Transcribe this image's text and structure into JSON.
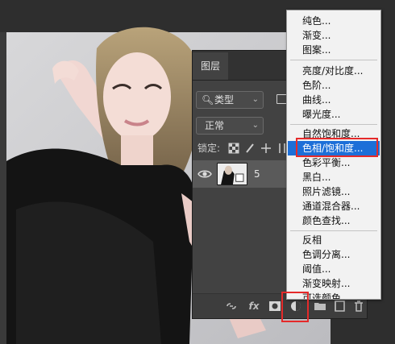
{
  "panel": {
    "tab_label": "图层",
    "filter_label": "类型",
    "blend_mode": "正常",
    "lock_label": "锁定:",
    "layers": [
      {
        "name": "5",
        "visible": true
      }
    ]
  },
  "footer_icons": [
    "link-icon",
    "fx-icon",
    "mask-icon",
    "adjustment-icon",
    "group-icon",
    "new-layer-icon",
    "trash-icon"
  ],
  "adjustment_menu": {
    "groups": [
      [
        "纯色...",
        "渐变...",
        "图案..."
      ],
      [
        "亮度/对比度...",
        "色阶...",
        "曲线...",
        "曝光度..."
      ],
      [
        "自然饱和度...",
        "色相/饱和度...",
        "色彩平衡...",
        "黑白...",
        "照片滤镜...",
        "通道混合器...",
        "颜色查找..."
      ],
      [
        "反相",
        "色调分离...",
        "阈值...",
        "渐变映射...",
        "可选颜色..."
      ]
    ],
    "highlighted": "色相/饱和度..."
  },
  "colors": {
    "highlight": "#1d6fd8",
    "annotation": "#e52a2a",
    "panel_bg": "#424242"
  }
}
